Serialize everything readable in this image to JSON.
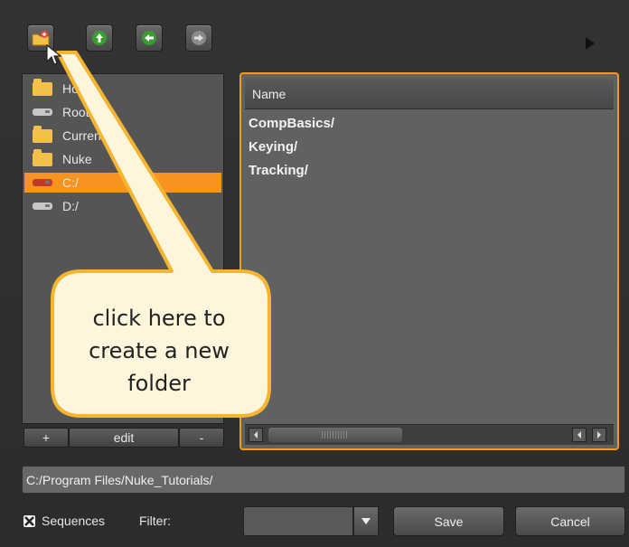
{
  "toolbar": {
    "buttons": [
      {
        "icon": "new-folder-icon"
      },
      {
        "icon": "arrow-up-icon"
      },
      {
        "icon": "arrow-left-icon"
      },
      {
        "icon": "arrow-right-icon"
      }
    ],
    "overflow_icon": "triangle-right-icon"
  },
  "sidebar": {
    "items": [
      {
        "label": "Home",
        "icon": "folder-icon"
      },
      {
        "label": "Root",
        "icon": "drive-icon"
      },
      {
        "label": "Current",
        "icon": "folder-icon"
      },
      {
        "label": "Nuke",
        "icon": "folder-icon"
      },
      {
        "label": "C:/",
        "icon": "drive-icon",
        "selected": true
      },
      {
        "label": "D:/",
        "icon": "drive-icon"
      }
    ],
    "add_label": "+",
    "edit_label": "edit",
    "remove_label": "-"
  },
  "file_list": {
    "column_header": "Name",
    "rows": [
      "CompBasics/",
      "Keying/",
      "Tracking/"
    ]
  },
  "path": {
    "value": "C:/Program Files/Nuke_Tutorials/"
  },
  "bottom": {
    "sequences_label": "Sequences",
    "filter_label": "Filter:",
    "filter_value": "",
    "save_label": "Save",
    "cancel_label": "Cancel"
  },
  "callout": {
    "text": "click here to\ncreate a new\nfolder"
  },
  "colors": {
    "accent": "#f7931e",
    "callout_fill": "#fdf6dc",
    "callout_border": "#f5b531",
    "background": "#2f2f2f"
  }
}
